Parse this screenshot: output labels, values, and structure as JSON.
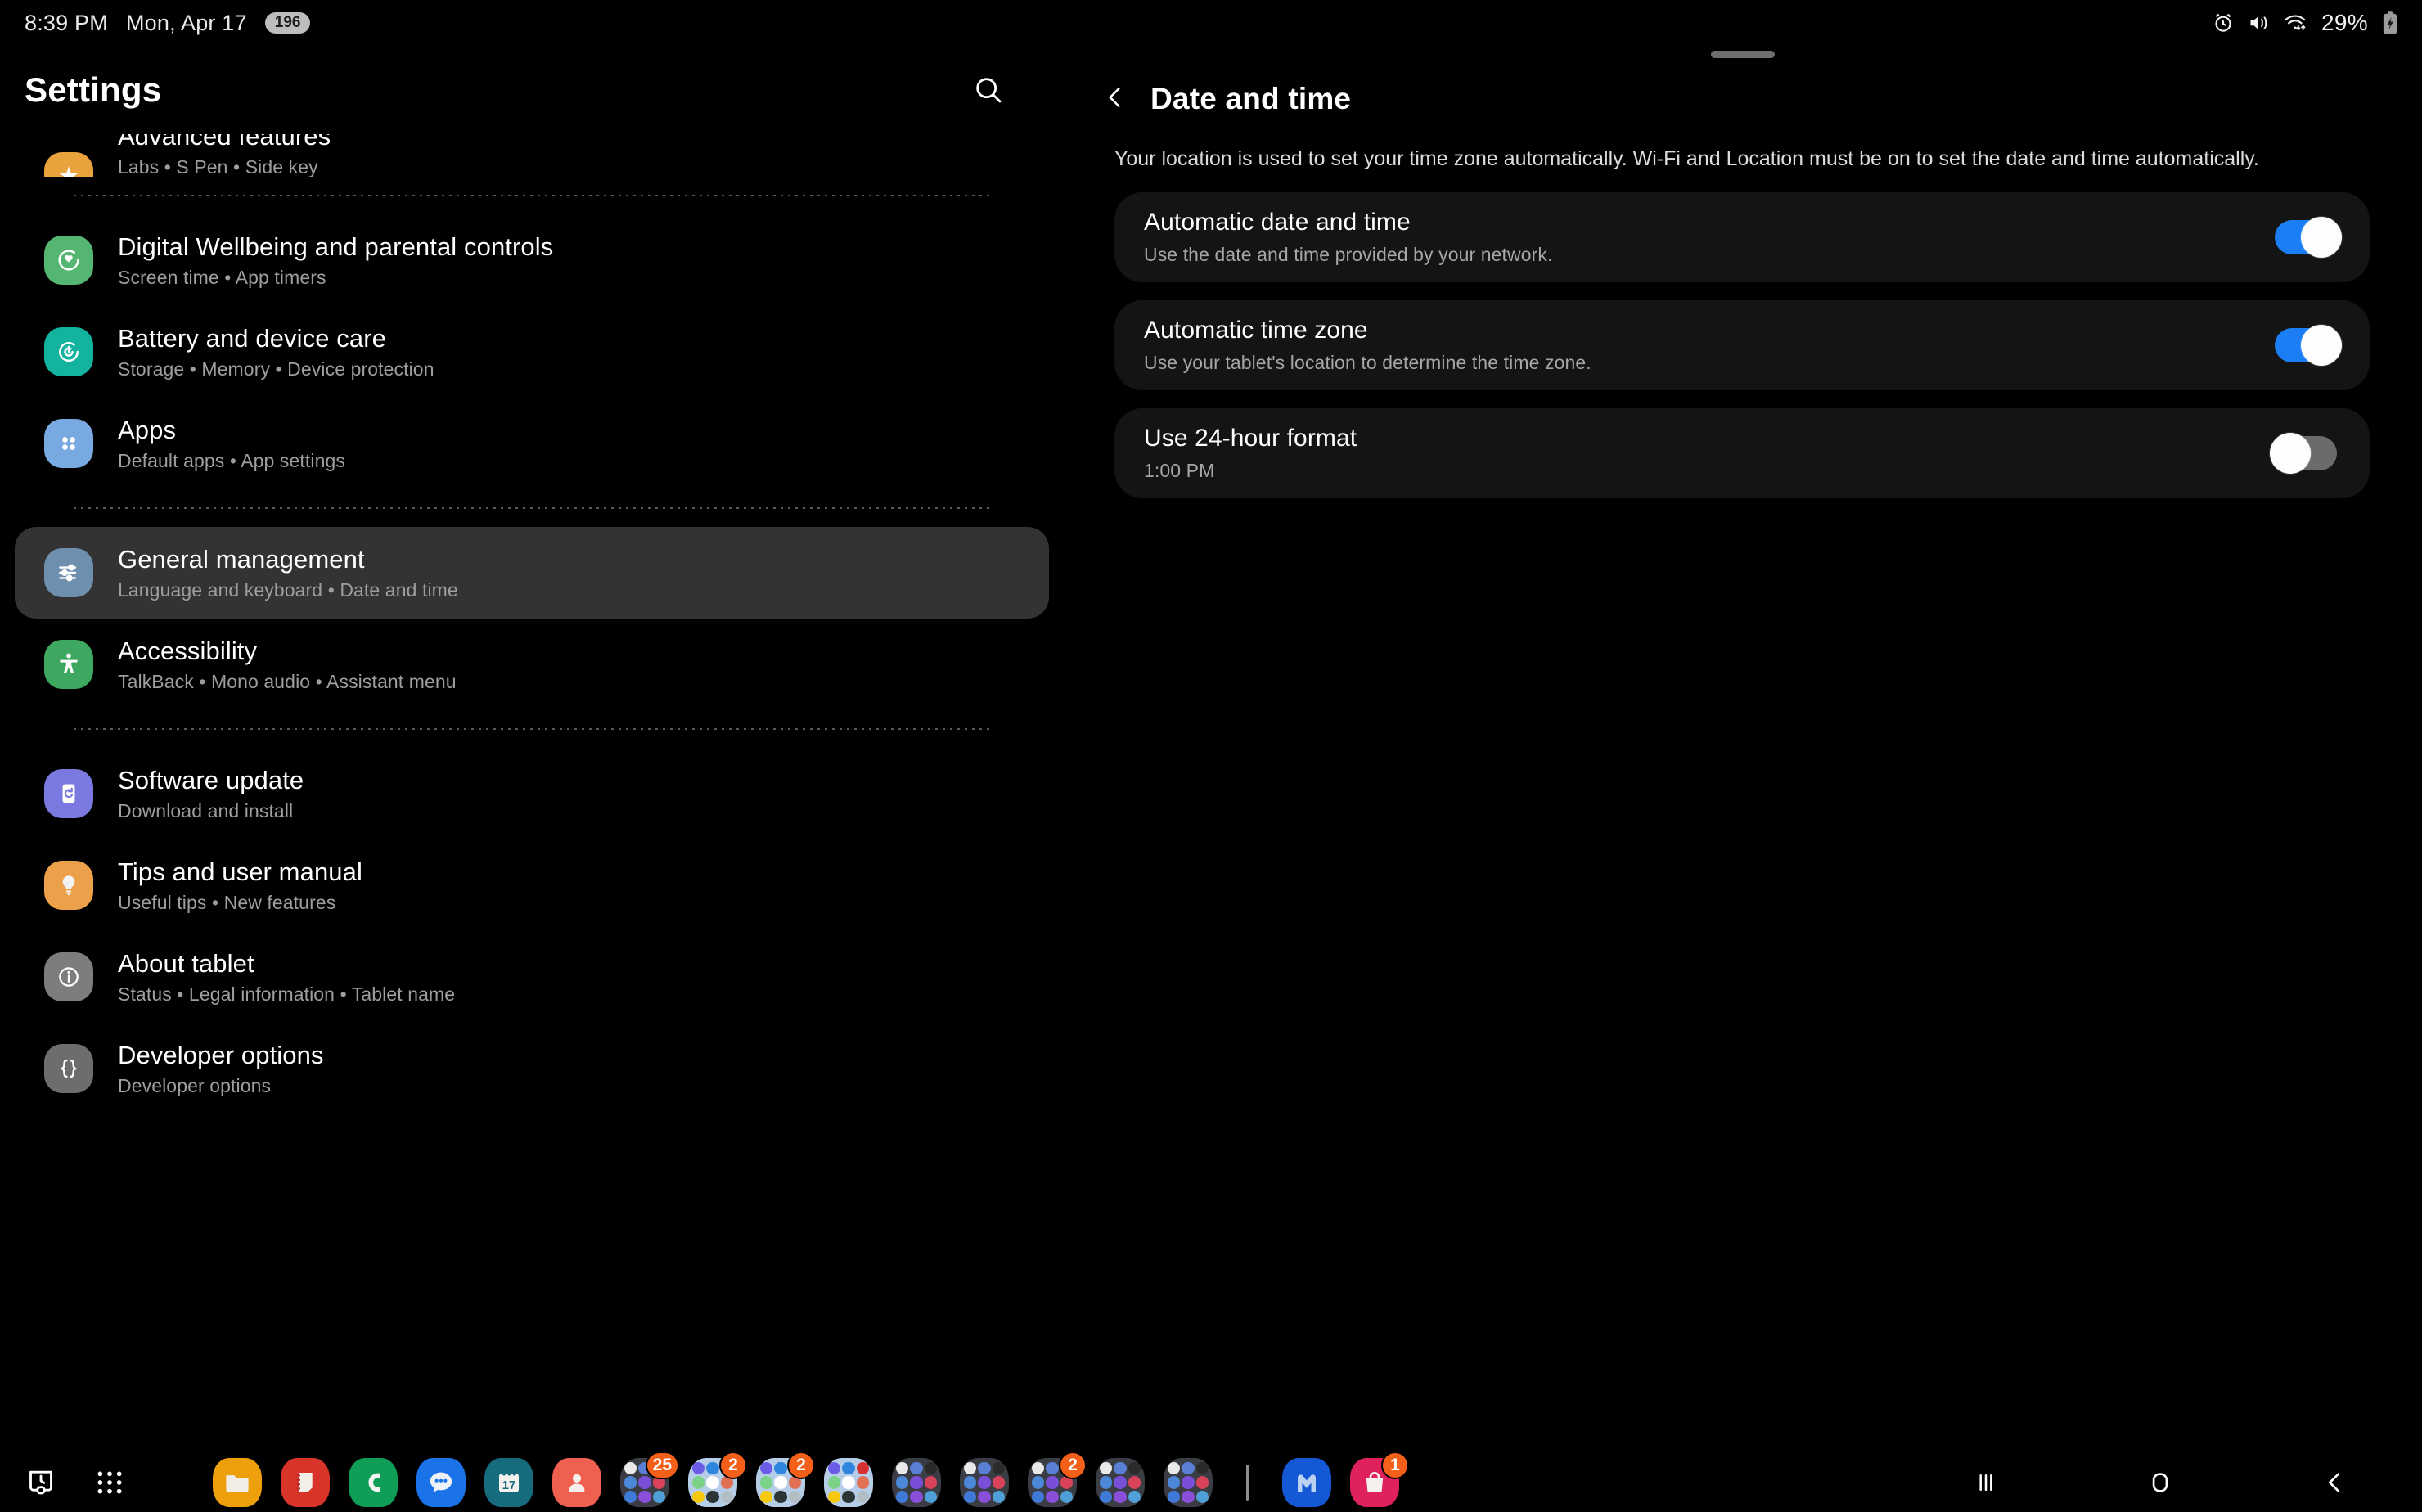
{
  "statusbar": {
    "time": "8:39 PM",
    "date": "Mon, Apr 17",
    "notification_count": "196",
    "battery_percent": "29%",
    "icons": [
      "alarm-icon",
      "mute-vibrate-icon",
      "wifi-icon",
      "battery-charging-icon"
    ]
  },
  "sidebar": {
    "title": "Settings",
    "search_icon": "search-icon",
    "items": [
      {
        "title": "Advanced features",
        "sub": "Labs  •  S Pen  •  Side key",
        "icon": "advanced-features-icon",
        "color": "#e8a33d",
        "clipped": true
      },
      {
        "divider": true
      },
      {
        "title": "Digital Wellbeing and parental controls",
        "sub": "Screen time  •  App timers",
        "icon": "digital-wellbeing-icon",
        "color": "#55b671"
      },
      {
        "title": "Battery and device care",
        "sub": "Storage  •  Memory  •  Device protection",
        "icon": "battery-device-care-icon",
        "color": "#13b3a0"
      },
      {
        "title": "Apps",
        "sub": "Default apps  •  App settings",
        "icon": "apps-icon",
        "color": "#78a9e0"
      },
      {
        "divider": true
      },
      {
        "title": "General management",
        "sub": "Language and keyboard  •  Date and time",
        "icon": "general-management-icon",
        "color": "#6f8fae",
        "selected": true
      },
      {
        "title": "Accessibility",
        "sub": "TalkBack  •  Mono audio  •  Assistant menu",
        "icon": "accessibility-icon",
        "color": "#3fa860"
      },
      {
        "divider": true
      },
      {
        "title": "Software update",
        "sub": "Download and install",
        "icon": "software-update-icon",
        "color": "#7a79e0"
      },
      {
        "title": "Tips and user manual",
        "sub": "Useful tips  •  New features",
        "icon": "tips-icon",
        "color": "#eda04a"
      },
      {
        "title": "About tablet",
        "sub": "Status  •  Legal information  •  Tablet name",
        "icon": "about-tablet-icon",
        "color": "#7d7d7d"
      },
      {
        "title": "Developer options",
        "sub": "Developer options",
        "icon": "developer-options-icon",
        "color": "#6d6d6d"
      }
    ]
  },
  "detail": {
    "back_icon": "back-chevron-icon",
    "title": "Date and time",
    "description": "Your location is used to set your time zone automatically. Wi-Fi and Location must be on to set the date and time automatically.",
    "settings": [
      {
        "title": "Automatic date and time",
        "sub": "Use the date and time provided by your network.",
        "state": "on"
      },
      {
        "title": "Automatic time zone",
        "sub": "Use your tablet's location to determine the time zone.",
        "state": "on"
      },
      {
        "title": "Use 24-hour format",
        "sub": "1:00 PM",
        "state": "off"
      }
    ]
  },
  "taskbar": {
    "system": [
      {
        "name": "recent-history-icon"
      },
      {
        "name": "app-drawer-icon"
      }
    ],
    "apps": [
      {
        "name": "my-files",
        "type": "solid",
        "color": "#eda00c",
        "glyph": "folder"
      },
      {
        "name": "samsung-notes",
        "type": "solid",
        "color": "#d8342a",
        "glyph": "note"
      },
      {
        "name": "phone",
        "type": "solid",
        "color": "#0f9d58",
        "glyph": "phone"
      },
      {
        "name": "messages",
        "type": "solid",
        "color": "#1a73e8",
        "glyph": "chat"
      },
      {
        "name": "calendar",
        "type": "solid",
        "color": "#166b7d",
        "glyph": "17"
      },
      {
        "name": "contacts",
        "type": "solid",
        "color": "#ef6050",
        "glyph": "person"
      },
      {
        "name": "app-folder-1",
        "type": "folder",
        "shade": "dark",
        "badge": "25"
      },
      {
        "name": "app-folder-2",
        "type": "folder",
        "shade": "light",
        "badge": "2"
      },
      {
        "name": "app-folder-3",
        "type": "folder",
        "shade": "light",
        "badge": "2"
      },
      {
        "name": "app-folder-4",
        "type": "folder",
        "shade": "light",
        "badge": ""
      },
      {
        "name": "app-folder-5",
        "type": "folder",
        "shade": "dark",
        "badge": ""
      },
      {
        "name": "app-folder-6",
        "type": "folder",
        "shade": "dark",
        "badge": ""
      },
      {
        "name": "app-folder-7",
        "type": "folder",
        "shade": "dark",
        "badge": "2"
      },
      {
        "name": "app-folder-8",
        "type": "folder",
        "shade": "dark",
        "badge": ""
      },
      {
        "name": "app-folder-9",
        "type": "folder",
        "shade": "dark",
        "badge": ""
      },
      {
        "name": "divider",
        "type": "divider"
      },
      {
        "name": "outlook",
        "type": "solid",
        "color": "#1558d6",
        "glyph": "M"
      },
      {
        "name": "galaxy-store",
        "type": "solid",
        "color": "#e0225c",
        "glyph": "bag",
        "badge": "1"
      }
    ],
    "nav": [
      {
        "name": "recents-button"
      },
      {
        "name": "home-button"
      },
      {
        "name": "back-button"
      }
    ]
  }
}
